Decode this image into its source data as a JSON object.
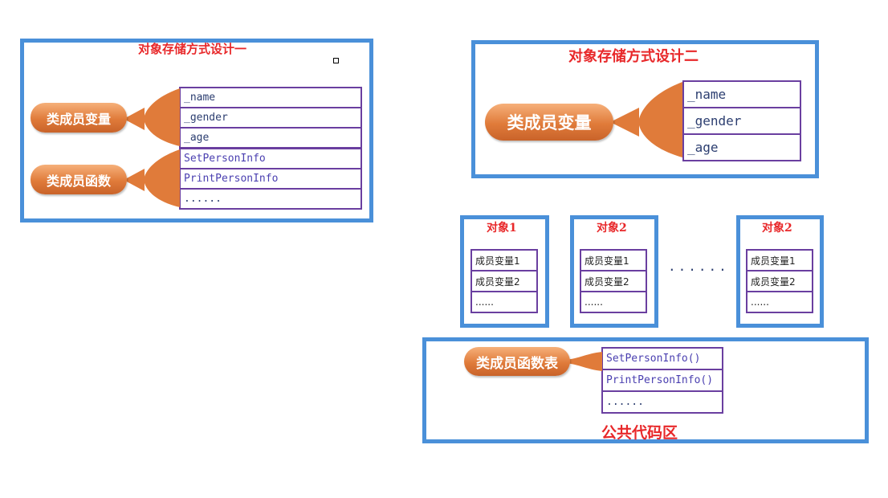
{
  "design1": {
    "title": "对象存储方式设计一",
    "var_label": "类成员变量",
    "func_label": "类成员函数",
    "vars": [
      "_name",
      "_gender",
      "_age"
    ],
    "funcs": [
      "SetPersonInfo",
      "PrintPersonInfo",
      "......"
    ]
  },
  "design2": {
    "title": "对象存储方式设计二",
    "var_label": "类成员变量",
    "vars": [
      "_name",
      "_gender",
      "_age"
    ]
  },
  "objects": [
    {
      "title": "对象1",
      "rows": [
        "成员变量1",
        "成员变量2",
        "......"
      ]
    },
    {
      "title": "对象2",
      "rows": [
        "成员变量1",
        "成员变量2",
        "......"
      ]
    },
    {
      "title": "对象2",
      "rows": [
        "成员变量1",
        "成员变量2",
        "......"
      ]
    }
  ],
  "objects_ellipsis": "......",
  "common": {
    "func_table_label": "类成员函数表",
    "funcs": [
      "SetPersonInfo()",
      "PrintPersonInfo()",
      "......"
    ],
    "area_title": "公共代码区"
  },
  "colors": {
    "panel_border": "#4a90d9",
    "title_red": "#e8282a",
    "table_border": "#6a3fa0",
    "pill_orange": "#e07b3a"
  }
}
